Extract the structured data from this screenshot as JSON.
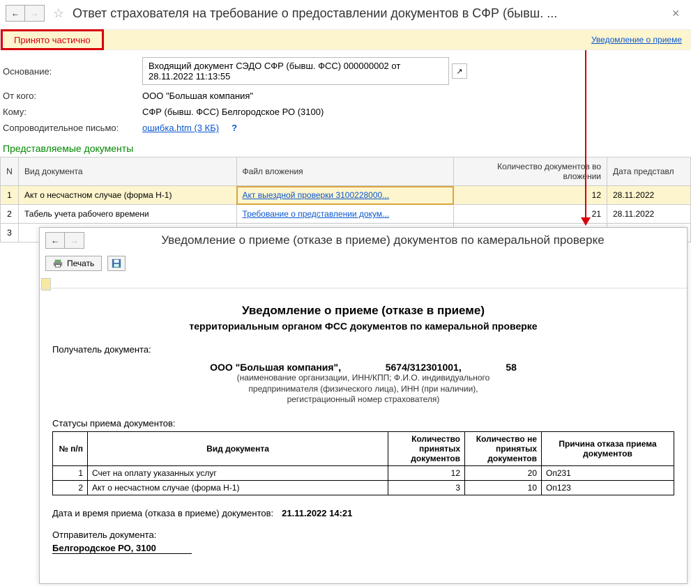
{
  "topbar": {
    "title": "Ответ страхователя на требование о предоставлении документов в СФР (бывш. ..."
  },
  "status": {
    "badge": "Принято частично",
    "notification_link": "Уведомление о приеме"
  },
  "info": {
    "basis_label": "Основание:",
    "basis_value": "Входящий документ СЭДО СФР (бывш. ФСС) 000000002 от 28.11.2022 11:13:55",
    "from_label": "От кого:",
    "from_value": "ООО \"Большая компания\"",
    "to_label": "Кому:",
    "to_value": "СФР (бывш. ФСС) Белгородское РО (3100)",
    "letter_label": "Сопроводительное письмо:",
    "letter_link": "ошибка.htm (3 КБ)",
    "help": "?"
  },
  "docs": {
    "section_title": "Представляемые документы",
    "headers": {
      "n": "N",
      "type": "Вид документа",
      "file": "Файл вложения",
      "count": "Количество документов во вложении",
      "date": "Дата представл"
    },
    "rows": [
      {
        "n": "1",
        "type": "Акт о несчастном случае (форма Н-1)",
        "file": "Акт выездной проверки 3100228000...",
        "count": "12",
        "date": "28.11.2022",
        "sel": true
      },
      {
        "n": "2",
        "type": "Табель учета рабочего времени",
        "file": "Требование о представлении докум...",
        "count": "21",
        "date": "28.11.2022",
        "sel": false
      },
      {
        "n": "3",
        "type": "",
        "file": "",
        "count": "",
        "date": "",
        "sel": false
      }
    ]
  },
  "modal": {
    "title": "Уведомление о приеме (отказе в приеме) документов по камеральной проверке",
    "print_label": "Печать",
    "doc": {
      "h1": "Уведомление о приеме (отказе в приеме)",
      "h2": "территориальным органом ФСС документов по камеральной проверке",
      "receiver_label": "Получатель документа:",
      "org_name": "ООО \"Большая компания\",",
      "org_code": "5674/312301001,",
      "org_num": "58",
      "org_note1": "(наименование организации, ИНН/КПП; Ф.И.О. индивидуального",
      "org_note2": "предпринимателя (физического лица), ИНН (при наличии),",
      "org_note3": "регистрационный номер страхователя)",
      "status_head": "Статусы приема документов:",
      "headers": {
        "n": "№ п/п",
        "type": "Вид документа",
        "accepted": "Количество принятых документов",
        "rejected": "Количество не принятых документов",
        "reason": "Причина отказа приема документов"
      },
      "rows": [
        {
          "n": "1",
          "type": "Счет на оплату указанных услуг",
          "accepted": "12",
          "rejected": "20",
          "reason": "Оп231"
        },
        {
          "n": "2",
          "type": "Акт о несчастном случае (форма Н-1)",
          "accepted": "3",
          "rejected": "10",
          "reason": "Оп123"
        }
      ],
      "datetime_label": "Дата и время приема (отказа в приеме) документов:",
      "datetime_value": "21.11.2022 14:21",
      "sender_label": "Отправитель документа:",
      "sender_value": "Белгородское РО, 3100"
    }
  }
}
